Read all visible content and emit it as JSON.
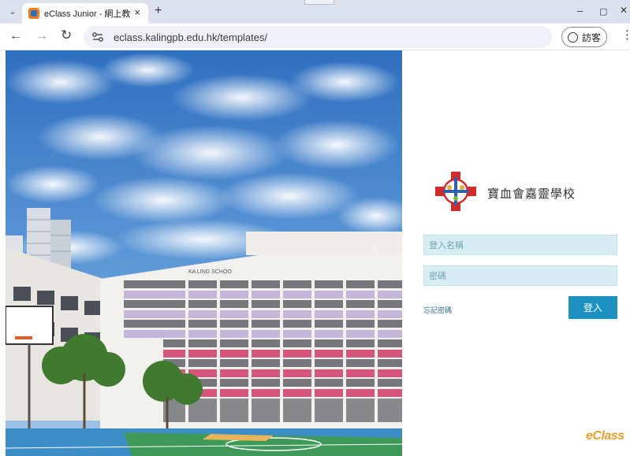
{
  "browser": {
    "tab_title": "eClass Junior - 網上教室內",
    "tab_close": "×",
    "new_tab": "+",
    "tab_menu": "⌄",
    "url": "eclass.kalingpb.edu.hk/templates/",
    "profile_label": "訪客",
    "minimize": "–",
    "maximize": "▢",
    "close": "✕",
    "back": "←",
    "forward": "→",
    "reload": "↻",
    "menu": "⋮"
  },
  "login": {
    "school_name": "寶血會嘉靈學校",
    "username_placeholder": "登入名稱",
    "password_placeholder": "密碼",
    "forgot_password": "忘記密碼",
    "login_button": "登入",
    "brand": "eClass"
  },
  "photo": {
    "building_sign": "KA LING SCHOO"
  },
  "colors": {
    "accent": "#1c91c0",
    "field_bg": "#d7ecf3",
    "brand_orange": "#e9a02b"
  }
}
